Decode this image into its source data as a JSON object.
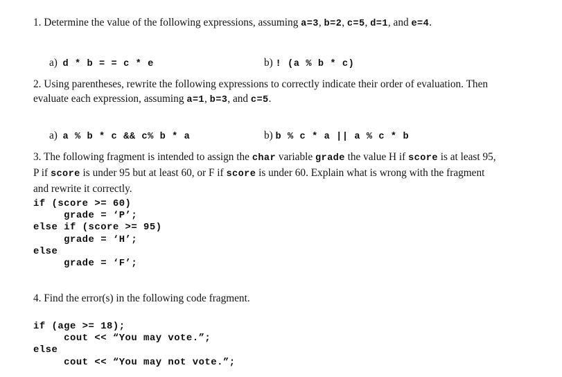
{
  "document": {
    "type": "programming-worksheet",
    "background_color": "#ffffff",
    "text_color": "#141414"
  },
  "questions": [
    {
      "number": "1.",
      "prompt_parts": [
        {
          "text": "1. Determine the value of the following expressions, assuming ",
          "style": "serif"
        },
        {
          "text": "a=3",
          "style": "mono"
        },
        {
          "text": ", ",
          "style": "serif"
        },
        {
          "text": "b=2",
          "style": "mono"
        },
        {
          "text": ", ",
          "style": "serif"
        },
        {
          "text": "c=5",
          "style": "mono"
        },
        {
          "text": ", ",
          "style": "serif"
        },
        {
          "text": "d=1",
          "style": "mono"
        },
        {
          "text": ",  and  ",
          "style": "serif"
        },
        {
          "text": "e=4",
          "style": "mono"
        },
        {
          "text": ".",
          "style": "serif"
        }
      ],
      "prompt_plain": "1. Determine the value of the following expressions, assuming a=3, b=2, c=5, d=1,  and  e=4.",
      "answers": [
        {
          "label": "a)",
          "expr": "d * b = = c * e"
        },
        {
          "label": "b)",
          "expr": "! (a % b * c)"
        }
      ]
    },
    {
      "number": "2.",
      "prompt_parts": [
        {
          "text": "2. Using parentheses, rewrite the following expressions to correctly indicate their order of evaluation. Then evaluate each expression, assuming ",
          "style": "serif"
        },
        {
          "text": "a=1",
          "style": "mono"
        },
        {
          "text": ",  ",
          "style": "serif"
        },
        {
          "text": "b=3",
          "style": "mono"
        },
        {
          "text": ", and ",
          "style": "serif"
        },
        {
          "text": "c=5",
          "style": "mono"
        },
        {
          "text": ".",
          "style": "serif"
        }
      ],
      "prompt_plain": "2. Using parentheses, rewrite the following expressions to correctly indicate their order of evaluation. Then evaluate each expression, assuming a=1,  b=3, and c=5.",
      "answers": [
        {
          "label": "a)",
          "expr": "a % b * c && c% b * a"
        },
        {
          "label": "b)",
          "expr": "b % c * a || a % c * b"
        }
      ]
    },
    {
      "number": "3.",
      "prompt_parts": [
        {
          "text": "3. The following fragment is intended to assign the ",
          "style": "serif"
        },
        {
          "text": "char",
          "style": "mono"
        },
        {
          "text": " variable ",
          "style": "serif"
        },
        {
          "text": "grade",
          "style": "mono"
        },
        {
          "text": " the value H if ",
          "style": "serif"
        },
        {
          "text": "score",
          "style": "mono"
        },
        {
          "text": " is at least 95, P if ",
          "style": "serif"
        },
        {
          "text": "score",
          "style": "mono"
        },
        {
          "text": " is under 95 but at least 60, or F if ",
          "style": "serif"
        },
        {
          "text": "score",
          "style": "mono"
        },
        {
          "text": " is under 60. Explain what is wrong with the fragment and rewrite it correctly.",
          "style": "serif"
        }
      ],
      "prompt_plain": "3. The following fragment is intended to assign the char variable grade the value H if score is at least 95, P if score is under 95 but at least 60, or F if score is under 60. Explain what is wrong with the fragment and rewrite it correctly.",
      "code": "if (score >= 60)\n     grade = ‘P’;\nelse if (score >= 95)\n     grade = ‘H’;\nelse\n     grade = ‘F’;"
    },
    {
      "number": "4.",
      "prompt_parts": [
        {
          "text": "4. Find the error(s) in the following code fragment.",
          "style": "serif"
        }
      ],
      "prompt_plain": "4. Find the error(s) in the following code fragment.",
      "code": "if (age >= 18);\n     cout << “You may vote.”;\nelse\n     cout << “You may not vote.”;"
    }
  ]
}
